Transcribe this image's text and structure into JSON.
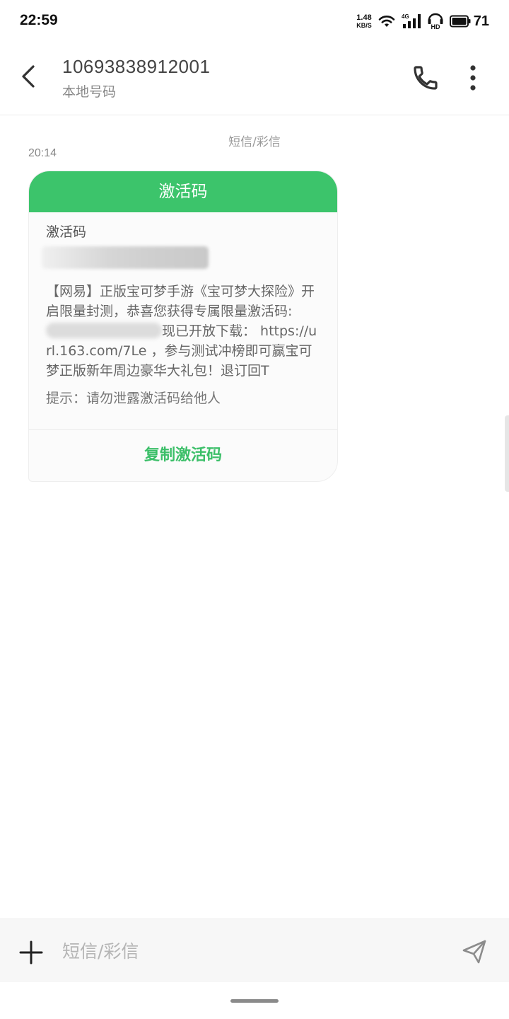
{
  "status_bar": {
    "time": "22:59",
    "net_speed_value": "1.48",
    "net_speed_unit": "KB/S",
    "network_type": "4G",
    "hd_label": "HD",
    "battery_percent": "71"
  },
  "header": {
    "contact_number": "10693838912001",
    "contact_subtitle": "本地号码",
    "icons": {
      "back": "back-arrow-icon",
      "call": "phone-icon",
      "more": "more-vertical-icon"
    }
  },
  "conversation": {
    "channel_label": "短信/彩信",
    "message": {
      "time": "20:14",
      "card_title": "激活码",
      "code_label": "激活码",
      "code_value_hidden": true,
      "text_part1": "【网易】正版宝可梦手游《宝可梦大探险》开启限量封测，恭喜您获得专属限量激活码:",
      "text_part2": "现已开放下载： https://url.163.com/7Le ，参与测试冲榜即可赢宝可梦正版新年周边豪华大礼包！退订回T",
      "tip": "提示：请勿泄露激活码给他人",
      "copy_button": "复制激活码"
    }
  },
  "compose": {
    "placeholder": "短信/彩信",
    "icons": {
      "attach": "plus-icon",
      "send": "send-icon"
    }
  },
  "colors": {
    "accent_green": "#3cc46b",
    "copy_text_green": "#3cbf69",
    "background": "#ffffff"
  }
}
